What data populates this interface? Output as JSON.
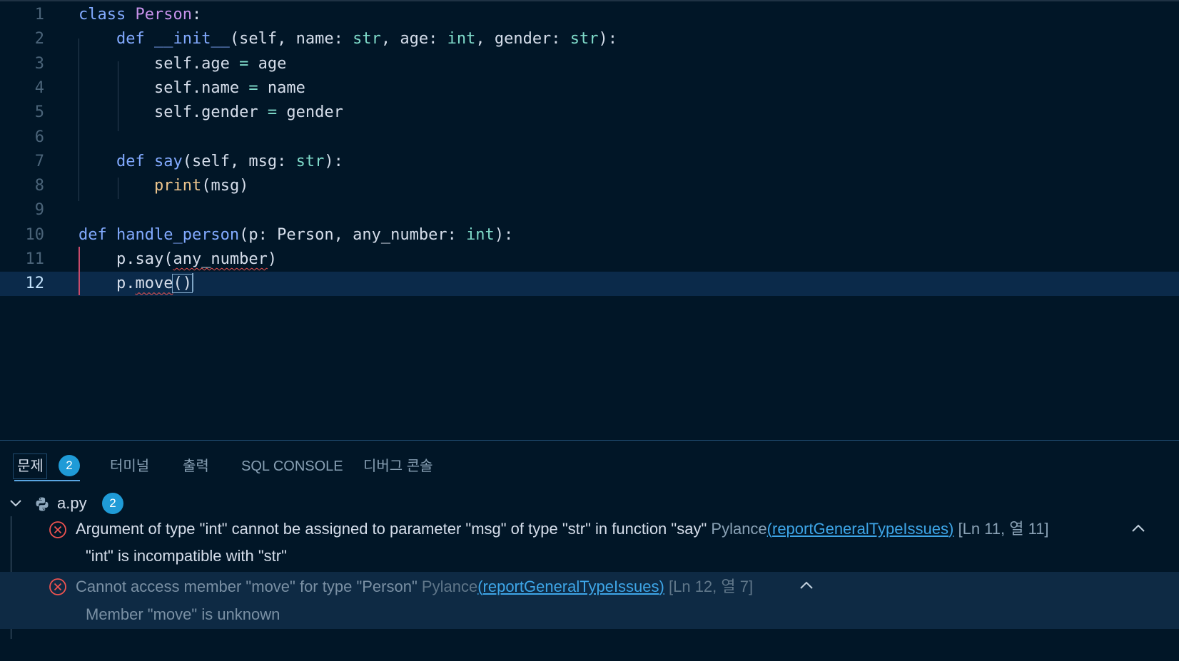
{
  "editor": {
    "lines": [
      {
        "n": "1",
        "tokens": [
          [
            "kw",
            "class "
          ],
          [
            "cls",
            "Person"
          ],
          [
            "pl",
            ":"
          ]
        ]
      },
      {
        "n": "2",
        "tokens": [
          [
            "pl",
            "    "
          ],
          [
            "kw",
            "def "
          ],
          [
            "fn",
            "__init__"
          ],
          [
            "pl",
            "(self, name: "
          ],
          [
            "type",
            "str"
          ],
          [
            "pl",
            ", age: "
          ],
          [
            "type",
            "int"
          ],
          [
            "pl",
            ", gender: "
          ],
          [
            "type",
            "str"
          ],
          [
            "pl",
            "):"
          ]
        ]
      },
      {
        "n": "3",
        "tokens": [
          [
            "pl",
            "        self.age "
          ],
          [
            "op",
            "="
          ],
          [
            "pl",
            " age"
          ]
        ]
      },
      {
        "n": "4",
        "tokens": [
          [
            "pl",
            "        self.name "
          ],
          [
            "op",
            "="
          ],
          [
            "pl",
            " name"
          ]
        ]
      },
      {
        "n": "5",
        "tokens": [
          [
            "pl",
            "        self.gender "
          ],
          [
            "op",
            "="
          ],
          [
            "pl",
            " gender"
          ]
        ]
      },
      {
        "n": "6",
        "tokens": []
      },
      {
        "n": "7",
        "tokens": [
          [
            "pl",
            "    "
          ],
          [
            "kw",
            "def "
          ],
          [
            "fn",
            "say"
          ],
          [
            "pl",
            "(self, msg: "
          ],
          [
            "type",
            "str"
          ],
          [
            "pl",
            "):"
          ]
        ]
      },
      {
        "n": "8",
        "tokens": [
          [
            "pl",
            "        "
          ],
          [
            "builtin",
            "print"
          ],
          [
            "pl",
            "(msg)"
          ]
        ]
      },
      {
        "n": "9",
        "tokens": []
      },
      {
        "n": "10",
        "tokens": [
          [
            "kw",
            "def "
          ],
          [
            "fn",
            "handle_person"
          ],
          [
            "pl",
            "(p: Person, any_number: "
          ],
          [
            "type",
            "int"
          ],
          [
            "pl",
            "):"
          ]
        ]
      },
      {
        "n": "11",
        "tokens": [
          [
            "pl",
            "    p.say("
          ],
          [
            "sq",
            "any_number"
          ],
          [
            "pl",
            ")"
          ]
        ]
      },
      {
        "n": "12",
        "tokens": [
          [
            "pl",
            "    p."
          ],
          [
            "sq",
            "move"
          ],
          [
            "br",
            "()"
          ],
          [
            "cur",
            ""
          ]
        ]
      }
    ],
    "active_line": "12"
  },
  "panel": {
    "tabs": [
      {
        "label": "문제",
        "badge": "2"
      },
      {
        "label": "터미널"
      },
      {
        "label": "출력"
      },
      {
        "label": "SQL CONSOLE"
      },
      {
        "label": "디버그 콘솔"
      }
    ],
    "file": {
      "name": "a.py",
      "count": "2",
      "icon": "python-icon"
    },
    "problems": [
      {
        "message": "Argument of type \"int\" cannot be assigned to parameter \"msg\" of type \"str\" in function \"say\"",
        "source": "Pylance",
        "rule_open": "(",
        "rule": "reportGeneralTypeIssues",
        "rule_close": ")",
        "location": "[Ln 11, 열 11]",
        "detail": "\"int\" is incompatible with \"str\""
      },
      {
        "message": "Cannot access member \"move\" for type \"Person\"",
        "source": "Pylance",
        "rule_open": "(",
        "rule": "reportGeneralTypeIssues",
        "rule_close": ")",
        "location": "[Ln 12, 열 7]",
        "detail": "Member \"move\" is unknown"
      }
    ]
  },
  "colors": {
    "background": "#011627",
    "error": "#ef5350",
    "link": "#3ea6e8",
    "badge": "#1f9bd7"
  }
}
